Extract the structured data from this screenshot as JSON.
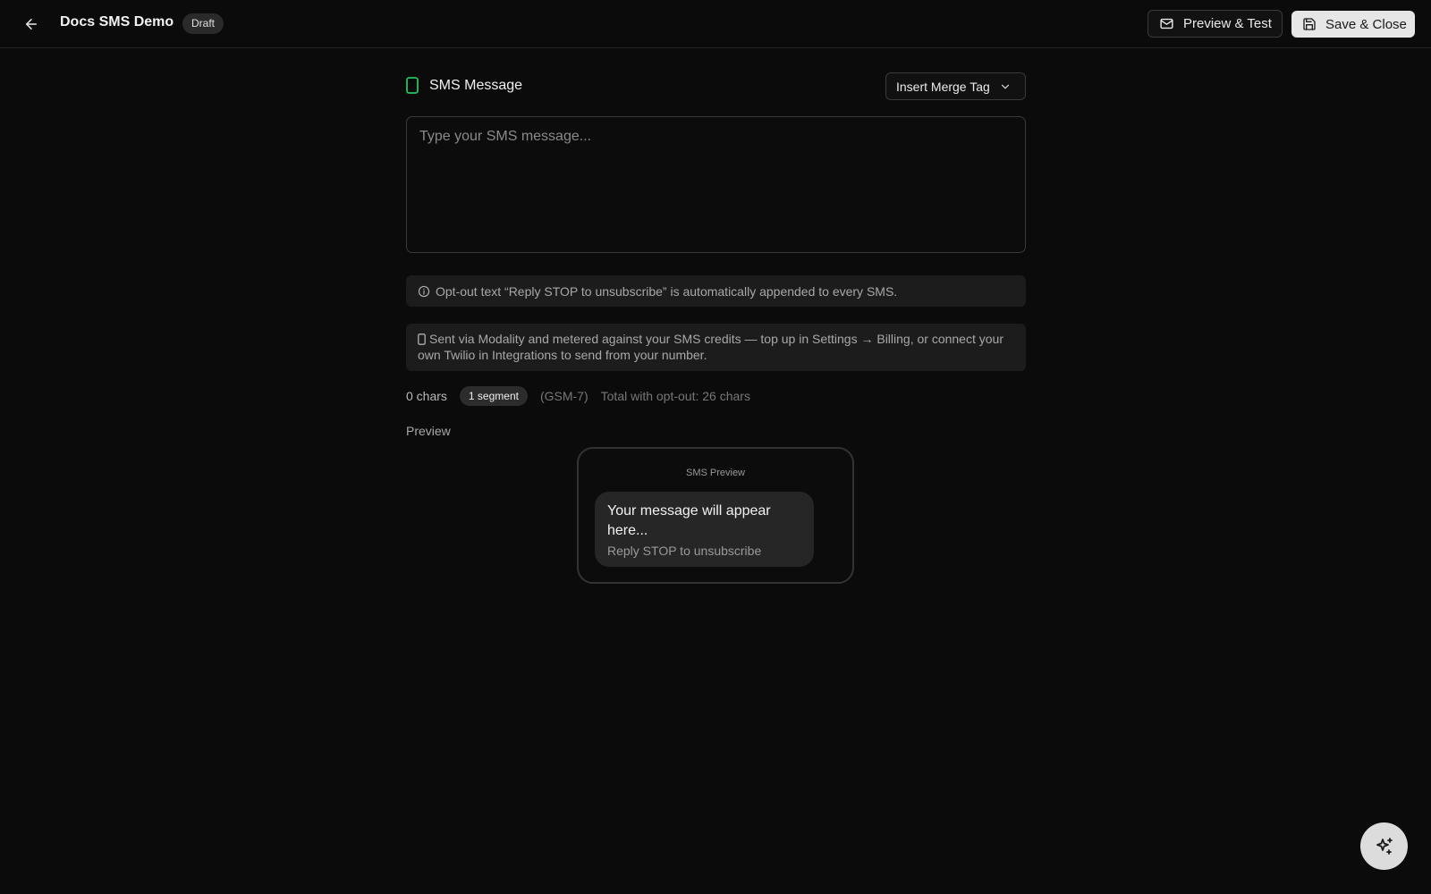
{
  "header": {
    "title": "Docs SMS Demo",
    "status_badge": "Draft",
    "preview_test_label": "Preview & Test",
    "save_close_label": "Save & Close"
  },
  "editor": {
    "section_title": "SMS Message",
    "merge_tag_label": "Insert Merge Tag",
    "message_value": "",
    "message_placeholder": "Type your SMS message..."
  },
  "notes": {
    "optout": "Opt-out text “Reply STOP to unsubscribe” is automatically appended to every SMS.",
    "billing": "Sent via Modality and metered against your SMS credits — top up in Settings → Billing, or connect your own Twilio in Integrations to send from your number."
  },
  "stats": {
    "chars": "0 chars",
    "segment": "1 segment",
    "encoding": "(GSM-7)",
    "total": "Total with opt-out: 26 chars"
  },
  "preview": {
    "label": "Preview",
    "phone_title": "SMS Preview",
    "message": "Your message will appear here...",
    "optout_line": "Reply STOP to unsubscribe"
  },
  "icons": {
    "back": "arrow-left-icon",
    "mail": "mail-icon",
    "save": "save-icon",
    "phone": "phone-icon",
    "chevron": "chevron-down-icon",
    "info": "info-icon",
    "sparkles": "sparkles-icon"
  },
  "colors": {
    "background": "#0b0b0b",
    "accent_green": "#22c55e",
    "primary_button": "#e6e6e6"
  }
}
